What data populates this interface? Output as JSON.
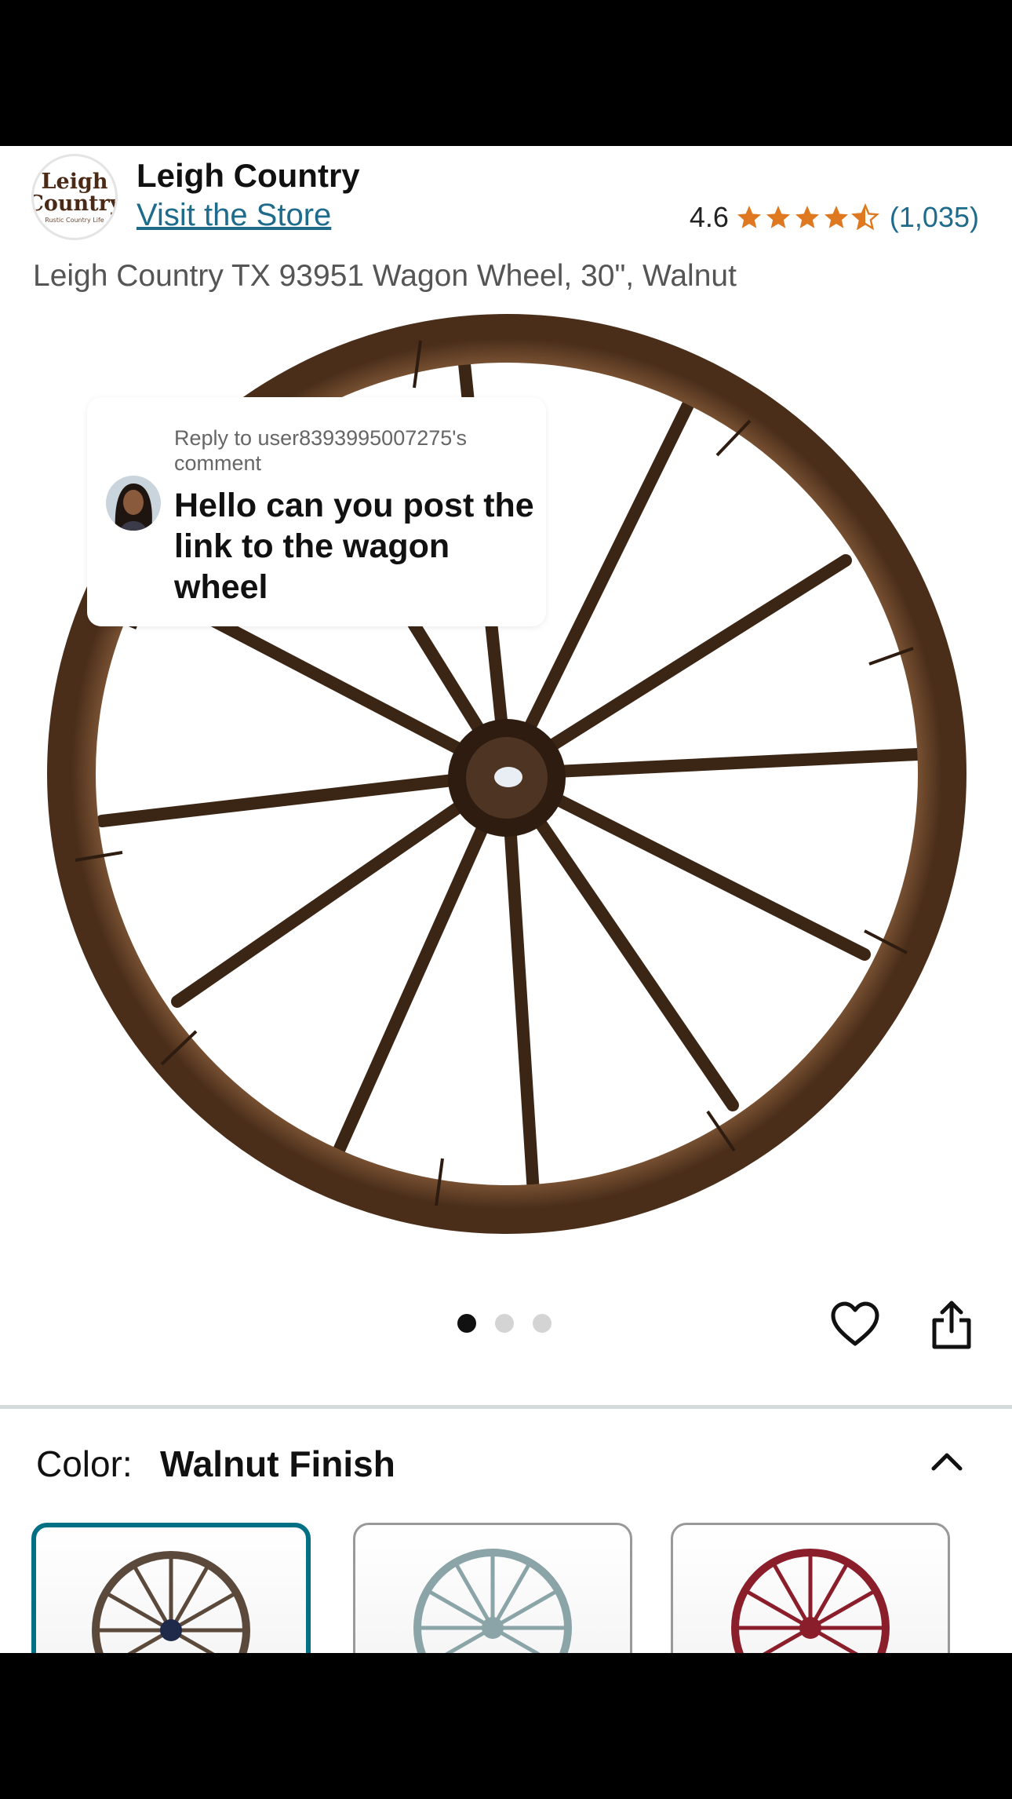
{
  "header": {
    "brand_name": "Leigh Country",
    "store_link": "Visit the Store",
    "logo": {
      "line1": "Leigh",
      "line2": "Country",
      "line3": "Rustic Country Life"
    },
    "rating": {
      "value": "4.6",
      "stars": 4.6,
      "count": "(1,035)"
    }
  },
  "product": {
    "title": "Leigh Country TX 93951 Wagon Wheel, 30\", Walnut"
  },
  "comment_overlay": {
    "reply_label": "Reply to user8393995007275's comment",
    "text": "Hello can you post the link to the wagon wheel"
  },
  "carousel": {
    "total": 3,
    "active_index": 0
  },
  "actions": {
    "favorite_icon": "heart-icon",
    "share_icon": "share-icon"
  },
  "variation": {
    "label": "Color:",
    "selected": "Walnut Finish",
    "swatches": [
      {
        "color": "#5b4a3c",
        "selected": true
      },
      {
        "color": "#8aa4a8",
        "selected": false
      },
      {
        "color": "#8b1e2b",
        "selected": false
      }
    ]
  },
  "colors": {
    "link": "#1e6b8c",
    "star": "#de7921",
    "selected_border": "#007185",
    "wood": "#5a3a22"
  }
}
